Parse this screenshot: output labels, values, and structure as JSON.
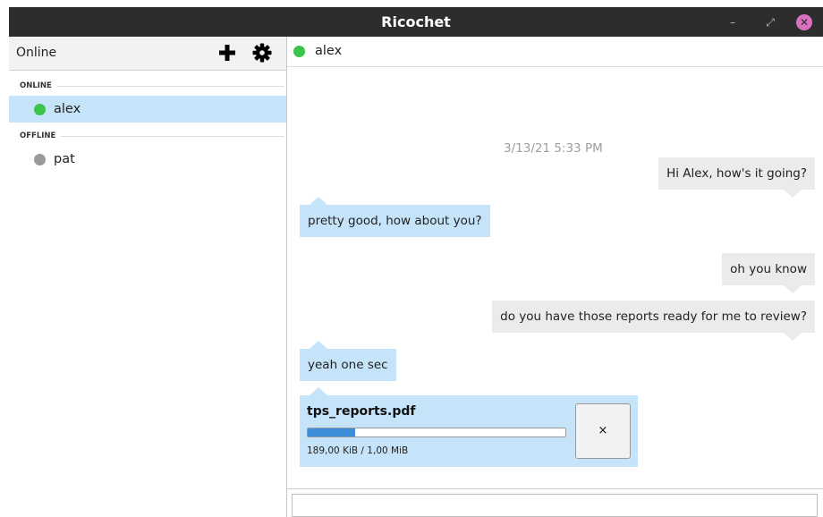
{
  "window": {
    "title": "Ricochet",
    "controls": {
      "minimize_glyph": "–",
      "maximize_glyph": "⤢",
      "close_glyph": "✕"
    }
  },
  "sidebar": {
    "status_label": "Online",
    "groups": [
      {
        "label": "ONLINE",
        "contacts": [
          {
            "name": "alex",
            "status": "online",
            "selected": true
          }
        ]
      },
      {
        "label": "OFFLINE",
        "contacts": [
          {
            "name": "pat",
            "status": "offline",
            "selected": false
          }
        ]
      }
    ]
  },
  "chat": {
    "contact_name": "alex",
    "contact_status": "online",
    "timestamp": "3/13/21 5:33 PM",
    "messages": [
      {
        "direction": "out",
        "text": "Hi Alex, how's it going?"
      },
      {
        "direction": "in",
        "text": "pretty good, how about you?"
      },
      {
        "direction": "out",
        "text": "oh you know"
      },
      {
        "direction": "out",
        "text": "do you have those reports ready for me to review?"
      },
      {
        "direction": "in",
        "text": "yeah one sec"
      }
    ],
    "file_transfer": {
      "file_name": "tps_reports.pdf",
      "size_text": "189,00 KiB / 1,00 MiB",
      "progress_fraction": 0.185,
      "cancel_glyph": "×"
    },
    "compose": {
      "value": "",
      "placeholder": ""
    }
  },
  "colors": {
    "titlebar": "#2d2d2d",
    "online": "#3cc34a",
    "offline": "#9a9a9a",
    "selected": "#c5e4fa",
    "incoming_bubble": "#c5e4fa",
    "outgoing_bubble": "#ebebeb",
    "progress": "#3d8ed8",
    "close_button": "#d970c0"
  },
  "icons": {
    "add": "add-contact-icon",
    "settings": "gear-icon",
    "status": "status-dot-icon"
  }
}
